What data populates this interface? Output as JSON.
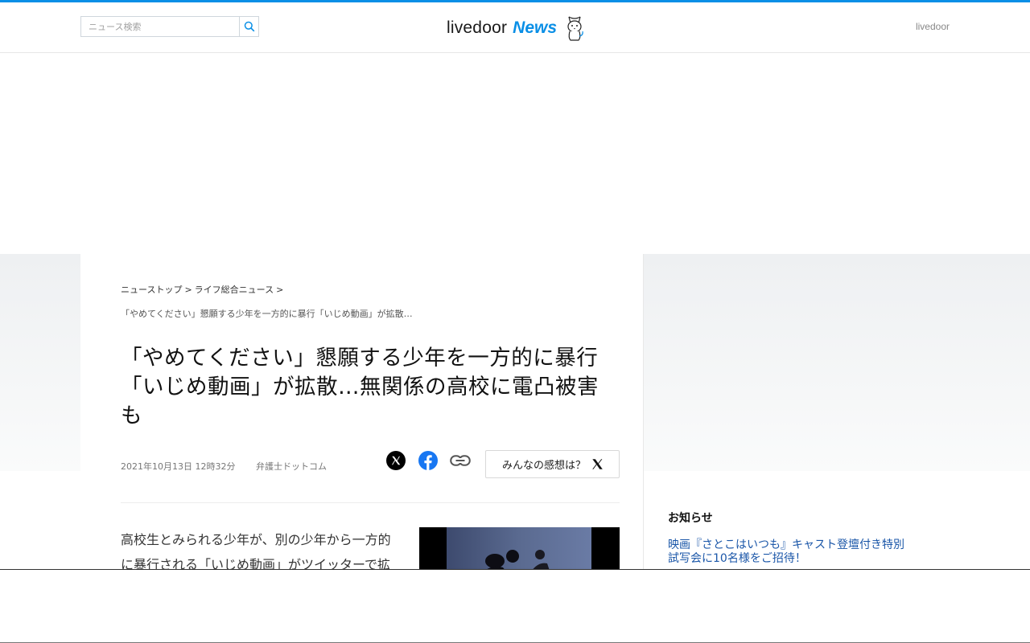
{
  "header": {
    "search": {
      "placeholder": "ニュース検索",
      "icon": "search-icon"
    },
    "logo": {
      "main": "livedoor",
      "news": "News",
      "mascot": "dog-mascot-icon"
    },
    "link": "livedoor",
    "accent_color": "#0a8fe6"
  },
  "breadcrumb": {
    "items": [
      "ニューストップ",
      "ライフ総合ニュース"
    ],
    "separator": ">",
    "current": "「やめてください」懇願する少年を一方的に暴行「いじめ動画」が拡散…"
  },
  "article": {
    "title": "「やめてください」懇願する少年を一方的に暴行「いじめ動画」が拡散…無関係の高校に電凸被害も",
    "date": "2021年10月13日 12時32分",
    "source": "弁護士ドットコム",
    "share": {
      "x": "x-icon",
      "facebook": "facebook-icon",
      "link": "link-icon"
    },
    "kansou_label": "みんなの感想は？",
    "body_lines": [
      "高校生とみられる少年が、別の少年から一方的",
      "に暴行される「いじめ動画」がツイッターで拡"
    ]
  },
  "sidebar": {
    "heading": "お知らせ",
    "link_lines": [
      "映画『さとこはいつも』キャスト登壇付き特別",
      "試写会に10名様をご招待！"
    ]
  }
}
